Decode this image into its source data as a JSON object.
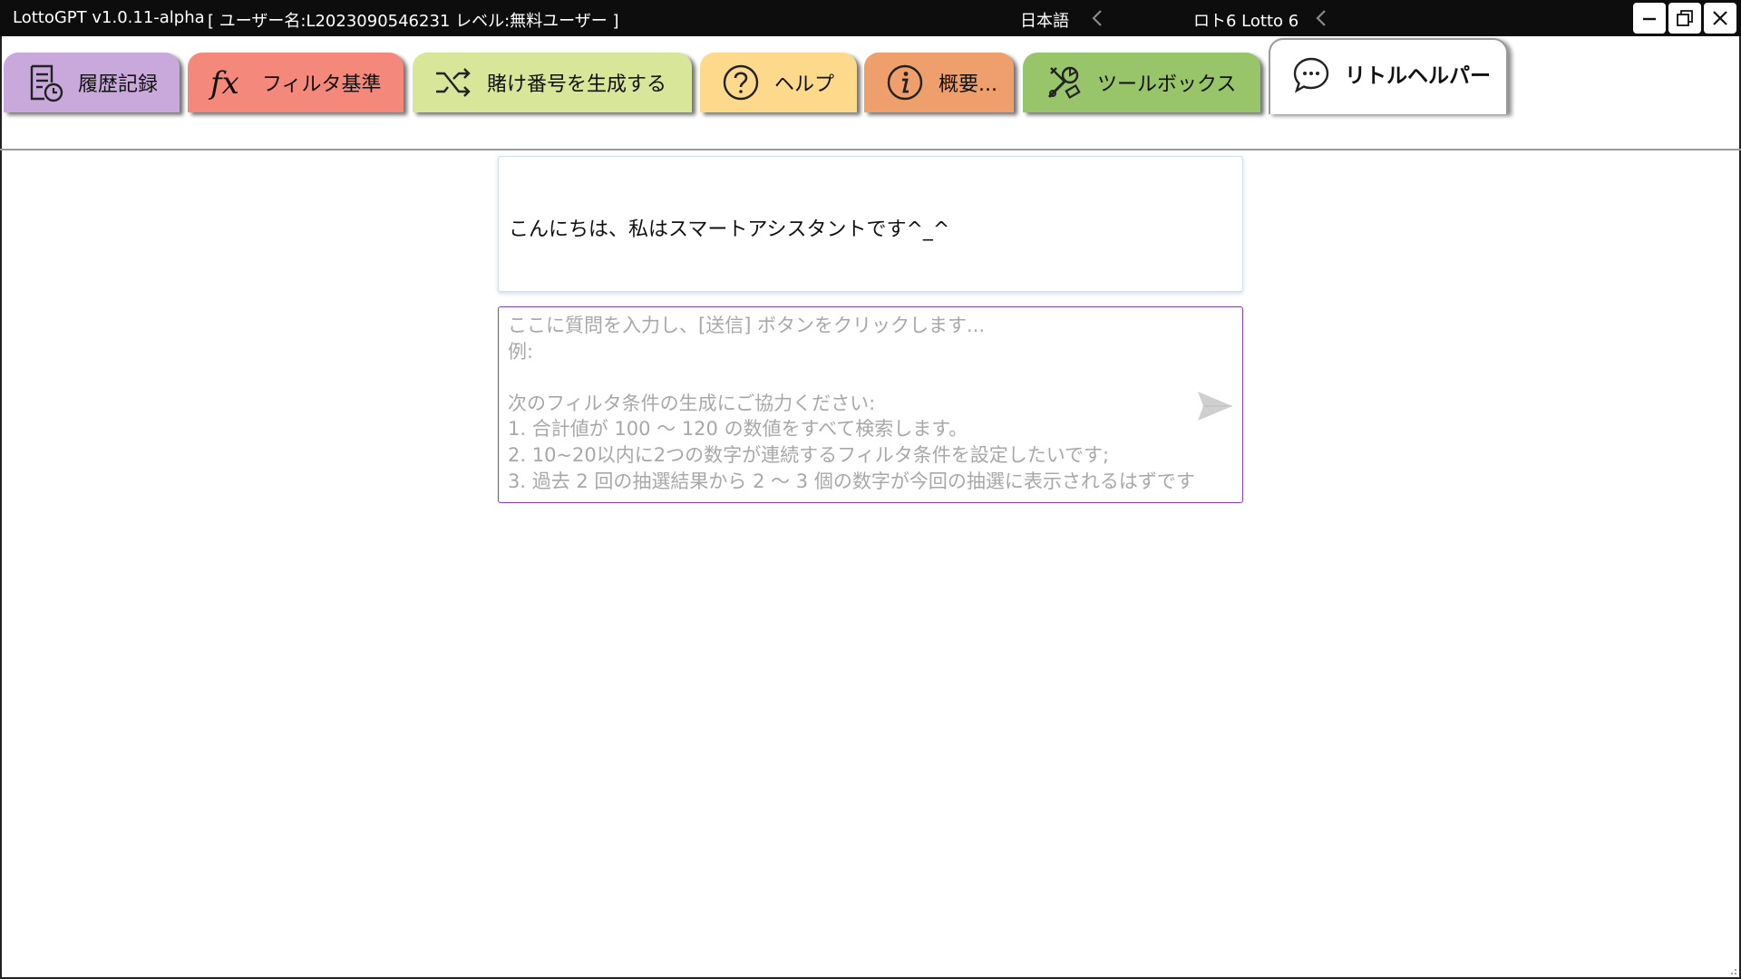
{
  "titlebar": {
    "app_title": "LottoGPT v1.0.11-alpha",
    "user_info": "[ ユーザー名:L2023090546231  レベル:無料ユーザー ]",
    "language": "日本語",
    "game": "ロト6 Lotto 6",
    "bg_color": "#0d0d0d"
  },
  "tabs": [
    {
      "label": "履歴記録",
      "icon": "history-list-icon",
      "color": "#c9a9dc"
    },
    {
      "label": "フィルタ基準",
      "icon": "fx-function-icon",
      "color": "#f4887a"
    },
    {
      "label": "賭け番号を生成する",
      "icon": "shuffle-icon",
      "color": "#d8e69a"
    },
    {
      "label": "ヘルプ",
      "icon": "question-circle-icon",
      "color": "#fdd98c"
    },
    {
      "label": "概要...",
      "icon": "info-circle-icon",
      "color": "#ef9f6b"
    },
    {
      "label": "ツールボックス",
      "icon": "tools-icon",
      "color": "#98c46a"
    },
    {
      "label": "リトルヘルパー",
      "icon": "chat-bubble-icon",
      "color": "#ffffff",
      "active": true
    }
  ],
  "assistant": {
    "greeting": "こんにちは、私はスマートアシスタントです^_^"
  },
  "question": {
    "value": "",
    "placeholder": "ここに質問を入力し、[送信] ボタンをクリックします...\n例:\n\n次のフィルタ条件の生成にご協力ください:\n1. 合計値が 100 ～ 120 の数値をすべて検索します。\n2. 10~20以内に2つの数字が連続するフィルタ条件を設定したいです;\n3. 過去 2 回の抽選結果から 2 ～ 3 個の数字が今回の抽選に表示されるはずです",
    "send_icon": "send-arrow-icon",
    "border_color": "#8a3ea8"
  }
}
